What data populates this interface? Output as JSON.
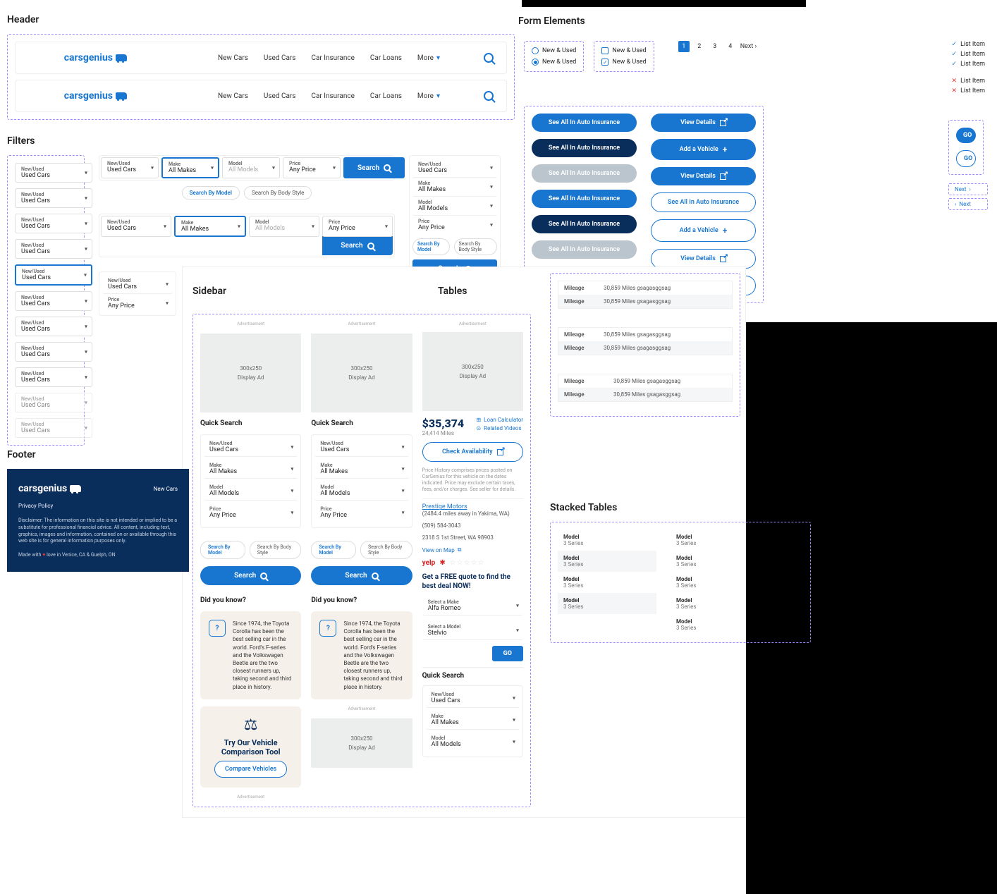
{
  "sections": {
    "header": "Header",
    "filters": "Filters",
    "footer": "Footer",
    "form_elements": "Form Elements",
    "sidebar": "Sidebar",
    "tables": "Tables",
    "stacked_tables": "Stacked Tables"
  },
  "brand": "carsgenius",
  "nav": {
    "new_cars": "New Cars",
    "used_cars": "Used Cars",
    "car_insurance": "Car Insurance",
    "car_loans": "Car Loans",
    "more": "More"
  },
  "filter_labels": {
    "new_used": "New/Used",
    "make": "Make",
    "model": "Model",
    "price": "Price"
  },
  "filter_values": {
    "used_cars": "Used Cars",
    "all_makes": "All Makes",
    "all_models": "All Models",
    "any_price": "Any Price"
  },
  "search": "Search",
  "chips": {
    "by_model": "Search By Model",
    "by_body": "Search By Body Style"
  },
  "form": {
    "new_used": "New & Used",
    "pages": [
      "1",
      "2",
      "3",
      "4"
    ],
    "next": "Next",
    "list_item": "List Item",
    "see_all": "See All In Auto Insurance",
    "view_details": "View Details",
    "add_vehicle": "Add a Vehicle",
    "go": "GO"
  },
  "sidebar": {
    "advertisement": "Advertisement",
    "ad_size": "300x250",
    "ad_label": "Display Ad",
    "quick_search": "Quick Search",
    "dyk": "Did you know?",
    "fact": "Since 1974, the Toyota Corolla has been the best selling car in the world. Ford's F-series and the Volkswagen Beetle are the two closest runners up, taking second and third place in history.",
    "tool_title": "Try Our Vehicle Comparison Tool",
    "compare": "Compare Vehicles"
  },
  "detail": {
    "price": "$35,374",
    "miles": "24,414 Miles",
    "loan_calc": "Loan Calculator",
    "related": "Related Videos",
    "check_avail": "Check Availability",
    "disclaimer": "Price History comprises prices posted on CarGenius for this vehicle on the dates indicated. Price may exclude certain taxes, fees, and/or charges. See seller for details.",
    "dealer": "Prestige Motors",
    "distance": "(2484.4 miles away in Yakima, WA)",
    "phone": "(509) 584-3043",
    "address": "2318 S 1st Street, WA 98903",
    "view_map": "View on Map",
    "yelp": "yelp",
    "quote": "Get a FREE quote to find the best deal NOW!",
    "select_make": "Select a Make",
    "alfa": "Alfa Romeo",
    "select_model": "Select a Model",
    "stelvio": "Stelvio",
    "go": "GO"
  },
  "tables": {
    "mileage": "Mileage",
    "value": "30,859 Miles gsagasggsag"
  },
  "stacked": {
    "model": "Model",
    "series": "3 Series"
  },
  "footer": {
    "new_cars": "New Cars",
    "privacy": "Privacy Policy",
    "disclaimer": "Disclaimer: The information on this site is not intended or implied to be a substitute for professional financial advice. All content, including text, graphics, images and information, contained on or available through this web site is for general information purposes only.",
    "made1": "Made with",
    "made2": "love in Venice, CA & Guelph, ON"
  }
}
